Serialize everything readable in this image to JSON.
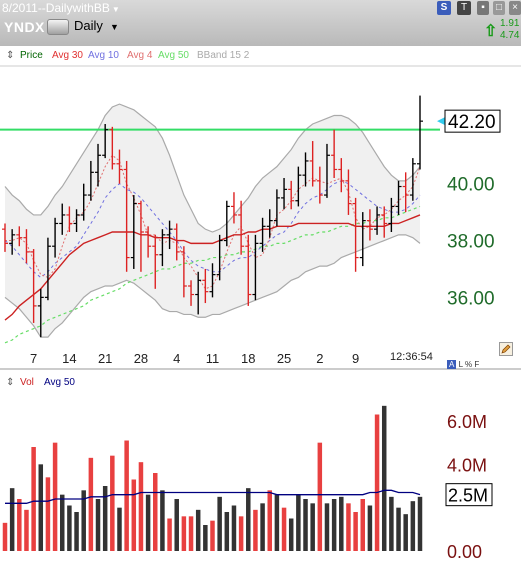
{
  "window": {
    "title": "8/2011--DailywithBB",
    "symbol": "YNDX",
    "period": "Daily",
    "quote_change": "1.91",
    "quote_pct": "4.74",
    "timestamp": "12:36:54",
    "mini_tools": [
      "A",
      "L",
      "%",
      "F"
    ],
    "buttons": {
      "s": "S",
      "t": "T"
    }
  },
  "legend": {
    "items": [
      {
        "label": "Price",
        "color": "#006400"
      },
      {
        "label": "Avg 30",
        "color": "#e03030"
      },
      {
        "label": "Avg 10",
        "color": "#7070e0"
      },
      {
        "label": "Avg 4",
        "color": "#e07070"
      },
      {
        "label": "Avg 50",
        "color": "#66dd66"
      },
      {
        "label": "BBand 15 2",
        "color": "#aaaaaa"
      }
    ]
  },
  "volume_legend": {
    "items": [
      {
        "label": "Vol",
        "color": "#cc2222"
      },
      {
        "label": "Avg 50",
        "color": "#000080"
      }
    ]
  },
  "chart_data": [
    {
      "type": "candlestick",
      "title": "",
      "xlabel": "",
      "ylabel": "",
      "ylim": [
        34.5,
        44.0
      ],
      "yticks": [
        "36.00",
        "38.00",
        "40.00"
      ],
      "xticks": [
        {
          "label": "7",
          "index": 4
        },
        {
          "label": "14",
          "index": 9
        },
        {
          "label": "21",
          "index": 14
        },
        {
          "label": "28",
          "index": 19
        },
        {
          "label": "4",
          "index": 24
        },
        {
          "label": "11",
          "index": 29
        },
        {
          "label": "18",
          "index": 34
        },
        {
          "label": "25",
          "index": 39
        },
        {
          "label": "2",
          "index": 44
        },
        {
          "label": "9",
          "index": 49
        }
      ],
      "last_price": "42.20",
      "horizontal_line": 41.9,
      "colors": {
        "up": "#000000",
        "down": "#dd2222",
        "hline": "#33dd66",
        "ma30": "#cc2222",
        "ma10": "#7070e0",
        "ma4": "#e07070",
        "ma50": "#66dd66",
        "band": "#aaaaaa",
        "band_fill": "#f0f0f0"
      },
      "ohlc": [
        [
          38.4,
          38.6,
          37.6,
          37.9
        ],
        [
          37.9,
          38.4,
          37.5,
          38.2
        ],
        [
          38.2,
          38.5,
          37.8,
          38.1
        ],
        [
          38.1,
          38.4,
          37.2,
          37.6
        ],
        [
          37.6,
          37.7,
          35.1,
          35.7
        ],
        [
          35.7,
          36.3,
          34.6,
          36.0
        ],
        [
          36.0,
          38.1,
          35.9,
          37.8
        ],
        [
          37.8,
          38.8,
          37.4,
          38.6
        ],
        [
          38.6,
          39.3,
          38.2,
          38.9
        ],
        [
          38.9,
          39.2,
          38.3,
          38.6
        ],
        [
          38.6,
          39.1,
          38.3,
          38.9
        ],
        [
          38.9,
          40.0,
          38.7,
          39.6
        ],
        [
          39.6,
          40.8,
          39.4,
          40.4
        ],
        [
          40.4,
          41.4,
          39.9,
          41.0
        ],
        [
          41.0,
          42.1,
          40.9,
          41.9
        ],
        [
          41.9,
          42.0,
          40.5,
          40.7
        ],
        [
          40.7,
          41.2,
          40.0,
          40.5
        ],
        [
          40.5,
          40.8,
          36.9,
          37.4
        ],
        [
          37.4,
          39.6,
          37.0,
          39.3
        ],
        [
          39.3,
          39.4,
          36.9,
          38.3
        ],
        [
          38.3,
          38.5,
          37.4,
          37.8
        ],
        [
          37.8,
          38.2,
          36.3,
          37.5
        ],
        [
          37.5,
          38.4,
          37.1,
          38.2
        ],
        [
          38.2,
          38.7,
          37.7,
          38.4
        ],
        [
          38.4,
          38.6,
          37.3,
          37.6
        ],
        [
          37.6,
          37.8,
          36.0,
          36.4
        ],
        [
          36.4,
          36.6,
          35.7,
          36.1
        ],
        [
          36.1,
          36.9,
          35.4,
          36.6
        ],
        [
          36.6,
          37.0,
          35.8,
          36.2
        ],
        [
          36.2,
          37.2,
          36.0,
          36.8
        ],
        [
          36.8,
          38.2,
          36.6,
          38.0
        ],
        [
          38.0,
          39.4,
          37.8,
          39.2
        ],
        [
          39.2,
          39.7,
          38.6,
          38.9
        ],
        [
          38.9,
          39.4,
          37.5,
          37.8
        ],
        [
          37.8,
          38.2,
          35.7,
          36.1
        ],
        [
          36.1,
          38.2,
          35.9,
          37.9
        ],
        [
          37.9,
          38.8,
          37.6,
          38.5
        ],
        [
          38.5,
          39.1,
          38.1,
          38.7
        ],
        [
          38.7,
          39.8,
          38.5,
          39.5
        ],
        [
          39.5,
          40.2,
          39.1,
          39.8
        ],
        [
          39.8,
          40.1,
          39.1,
          39.4
        ],
        [
          39.4,
          40.6,
          39.2,
          40.3
        ],
        [
          40.3,
          41.1,
          39.9,
          40.8
        ],
        [
          40.8,
          41.5,
          39.9,
          40.1
        ],
        [
          40.1,
          40.6,
          39.3,
          39.6
        ],
        [
          39.6,
          41.4,
          39.5,
          41.0
        ],
        [
          41.0,
          41.9,
          40.2,
          40.5
        ],
        [
          40.5,
          40.9,
          39.7,
          40.1
        ],
        [
          40.1,
          40.5,
          38.9,
          39.3
        ],
        [
          39.3,
          39.5,
          36.9,
          37.4
        ],
        [
          37.4,
          39.0,
          37.1,
          38.7
        ],
        [
          38.7,
          39.1,
          38.0,
          38.4
        ],
        [
          38.4,
          39.2,
          38.2,
          38.9
        ],
        [
          38.9,
          39.2,
          38.1,
          38.6
        ],
        [
          38.6,
          39.5,
          38.3,
          39.2
        ],
        [
          39.2,
          40.1,
          38.9,
          39.9
        ],
        [
          39.9,
          40.4,
          39.0,
          39.6
        ],
        [
          39.6,
          40.9,
          39.4,
          40.7
        ],
        [
          40.7,
          43.1,
          40.5,
          42.2
        ]
      ],
      "ma30": [
        35.2,
        35.4,
        35.7,
        35.9,
        36.1,
        36.3,
        36.6,
        36.9,
        37.2,
        37.5,
        37.7,
        37.9,
        38.0,
        38.1,
        38.2,
        38.3,
        38.3,
        38.3,
        38.3,
        38.2,
        38.2,
        38.1,
        38.1,
        38.1,
        38.0,
        38.0,
        37.9,
        37.9,
        37.9,
        37.9,
        38.0,
        38.1,
        38.2,
        38.2,
        38.3,
        38.3,
        38.4,
        38.4,
        38.5,
        38.5,
        38.5,
        38.6,
        38.6,
        38.6,
        38.6,
        38.6,
        38.6,
        38.6,
        38.6,
        38.5,
        38.5,
        38.5,
        38.5,
        38.5,
        38.6,
        38.6,
        38.7,
        38.8,
        38.9
      ],
      "ma10": [
        38.0,
        37.8,
        37.5,
        37.2,
        36.9,
        36.7,
        36.9,
        37.2,
        37.4,
        37.6,
        37.8,
        38.2,
        38.6,
        39.0,
        39.5,
        39.8,
        40.0,
        39.8,
        39.7,
        39.5,
        39.2,
        38.9,
        38.6,
        38.3,
        38.0,
        37.6,
        37.3,
        37.1,
        37.0,
        36.9,
        36.9,
        37.1,
        37.3,
        37.4,
        37.4,
        37.6,
        37.8,
        38.0,
        38.2,
        38.3,
        38.6,
        39.0,
        39.3,
        39.5,
        39.6,
        39.8,
        40.0,
        40.1,
        40.0,
        39.8,
        39.6,
        39.4,
        39.2,
        39.1,
        39.0,
        39.0,
        39.1,
        39.3,
        39.6
      ],
      "ma4": [
        38.0,
        38.0,
        38.1,
        37.9,
        37.3,
        36.8,
        36.7,
        37.0,
        37.8,
        38.5,
        38.8,
        39.0,
        39.4,
        40.0,
        40.6,
        41.0,
        40.8,
        40.0,
        39.5,
        38.9,
        38.2,
        38.2,
        37.9,
        38.0,
        37.9,
        37.4,
        37.1,
        36.7,
        36.3,
        36.4,
        36.9,
        37.6,
        38.2,
        38.5,
        37.9,
        37.4,
        37.5,
        38.1,
        38.9,
        39.1,
        39.4,
        39.8,
        40.0,
        40.2,
        40.1,
        40.0,
        40.1,
        40.2,
        39.7,
        38.8,
        38.4,
        38.5,
        38.8,
        38.9,
        39.1,
        39.4,
        39.6,
        39.9,
        40.6
      ],
      "ma50": [
        34.4,
        34.5,
        34.7,
        34.8,
        34.9,
        35.0,
        35.2,
        35.3,
        35.4,
        35.5,
        35.6,
        35.7,
        35.9,
        36.0,
        36.1,
        36.2,
        36.3,
        36.5,
        36.6,
        36.7,
        36.8,
        36.9,
        37.0,
        37.0,
        37.1,
        37.2,
        37.2,
        37.3,
        37.3,
        37.4,
        37.4,
        37.5,
        37.5,
        37.6,
        37.6,
        37.7,
        37.8,
        37.8,
        37.9,
        37.9,
        38.0,
        38.1,
        38.2,
        38.2,
        38.3,
        38.3,
        38.4,
        38.5,
        38.5,
        38.6,
        38.6,
        38.7,
        38.7,
        38.8,
        38.8,
        38.9,
        39.0,
        39.1,
        39.2
      ],
      "bb_upper": [
        39.9,
        39.6,
        39.4,
        39.1,
        38.9,
        38.9,
        39.2,
        39.6,
        39.9,
        40.3,
        40.7,
        41.1,
        41.5,
        41.9,
        42.4,
        42.7,
        42.8,
        42.7,
        42.6,
        42.4,
        42.2,
        42.0,
        41.6,
        41.0,
        40.3,
        39.6,
        39.1,
        38.6,
        38.4,
        38.3,
        38.4,
        38.6,
        38.9,
        39.2,
        39.5,
        39.9,
        40.2,
        40.4,
        40.6,
        40.9,
        41.2,
        41.6,
        41.9,
        42.1,
        42.2,
        42.3,
        42.4,
        42.4,
        42.3,
        42.1,
        41.8,
        41.4,
        41.0,
        40.6,
        40.3,
        40.1,
        40.1,
        40.3,
        40.6
      ],
      "bb_lower": [
        36.0,
        35.8,
        35.6,
        35.3,
        35.0,
        34.6,
        34.6,
        34.9,
        35.1,
        35.4,
        35.7,
        36.0,
        36.2,
        36.3,
        36.4,
        36.4,
        36.5,
        36.6,
        36.5,
        36.3,
        36.1,
        35.9,
        35.6,
        35.5,
        35.5,
        35.4,
        35.4,
        35.3,
        35.3,
        35.4,
        35.4,
        35.5,
        35.6,
        35.7,
        35.8,
        35.9,
        36.0,
        36.1,
        36.2,
        36.4,
        36.6,
        36.7,
        36.9,
        37.0,
        37.1,
        37.1,
        37.2,
        37.4,
        37.5,
        37.6,
        37.7,
        37.8,
        37.9,
        38.0,
        38.1,
        38.2,
        38.2,
        38.1,
        37.9
      ]
    },
    {
      "type": "bar",
      "title": "",
      "xlabel": "",
      "ylabel": "",
      "ylim": [
        0,
        7.2
      ],
      "yticks": [
        "0.00",
        "4.0M",
        "6.0M"
      ],
      "avg_label": "2.5M",
      "units": "M",
      "colors": {
        "up": "#333333",
        "down": "#e84040",
        "avg": "#000080"
      },
      "volume": [
        {
          "v": 1.3,
          "up": false
        },
        {
          "v": 2.9,
          "up": true
        },
        {
          "v": 2.4,
          "up": false
        },
        {
          "v": 1.9,
          "up": false
        },
        {
          "v": 4.8,
          "up": false
        },
        {
          "v": 4.0,
          "up": true
        },
        {
          "v": 3.4,
          "up": false
        },
        {
          "v": 5.0,
          "up": false
        },
        {
          "v": 2.6,
          "up": true
        },
        {
          "v": 2.1,
          "up": true
        },
        {
          "v": 1.8,
          "up": true
        },
        {
          "v": 2.8,
          "up": true
        },
        {
          "v": 4.3,
          "up": false
        },
        {
          "v": 2.4,
          "up": true
        },
        {
          "v": 3.0,
          "up": true
        },
        {
          "v": 4.4,
          "up": false
        },
        {
          "v": 2.0,
          "up": true
        },
        {
          "v": 5.1,
          "up": false
        },
        {
          "v": 3.3,
          "up": false
        },
        {
          "v": 4.1,
          "up": false
        },
        {
          "v": 2.6,
          "up": true
        },
        {
          "v": 3.6,
          "up": false
        },
        {
          "v": 2.8,
          "up": true
        },
        {
          "v": 1.5,
          "up": false
        },
        {
          "v": 2.4,
          "up": true
        },
        {
          "v": 1.6,
          "up": false
        },
        {
          "v": 1.6,
          "up": false
        },
        {
          "v": 1.9,
          "up": true
        },
        {
          "v": 1.2,
          "up": true
        },
        {
          "v": 1.4,
          "up": false
        },
        {
          "v": 2.5,
          "up": true
        },
        {
          "v": 1.8,
          "up": true
        },
        {
          "v": 2.1,
          "up": true
        },
        {
          "v": 1.6,
          "up": false
        },
        {
          "v": 2.9,
          "up": true
        },
        {
          "v": 1.9,
          "up": false
        },
        {
          "v": 2.2,
          "up": true
        },
        {
          "v": 2.8,
          "up": false
        },
        {
          "v": 2.6,
          "up": true
        },
        {
          "v": 2.0,
          "up": false
        },
        {
          "v": 1.5,
          "up": true
        },
        {
          "v": 2.6,
          "up": true
        },
        {
          "v": 2.4,
          "up": true
        },
        {
          "v": 2.2,
          "up": true
        },
        {
          "v": 5.0,
          "up": false
        },
        {
          "v": 2.2,
          "up": true
        },
        {
          "v": 2.4,
          "up": true
        },
        {
          "v": 2.5,
          "up": true
        },
        {
          "v": 2.2,
          "up": false
        },
        {
          "v": 1.8,
          "up": false
        },
        {
          "v": 2.4,
          "up": false
        },
        {
          "v": 2.1,
          "up": true
        },
        {
          "v": 6.3,
          "up": false
        },
        {
          "v": 6.7,
          "up": true
        },
        {
          "v": 2.5,
          "up": true
        },
        {
          "v": 2.0,
          "up": true
        },
        {
          "v": 1.7,
          "up": true
        },
        {
          "v": 2.3,
          "up": true
        },
        {
          "v": 2.5,
          "up": true
        }
      ],
      "avg": [
        2.2,
        2.2,
        2.2,
        2.2,
        2.3,
        2.3,
        2.3,
        2.4,
        2.4,
        2.4,
        2.4,
        2.4,
        2.5,
        2.5,
        2.5,
        2.6,
        2.6,
        2.6,
        2.6,
        2.7,
        2.7,
        2.7,
        2.7,
        2.7,
        2.7,
        2.7,
        2.7,
        2.7,
        2.7,
        2.7,
        2.7,
        2.7,
        2.7,
        2.7,
        2.7,
        2.7,
        2.7,
        2.7,
        2.6,
        2.6,
        2.6,
        2.6,
        2.6,
        2.6,
        2.6,
        2.6,
        2.6,
        2.6,
        2.6,
        2.6,
        2.6,
        2.7,
        2.7,
        2.8,
        2.8,
        2.7,
        2.7,
        2.7,
        2.6
      ]
    }
  ]
}
